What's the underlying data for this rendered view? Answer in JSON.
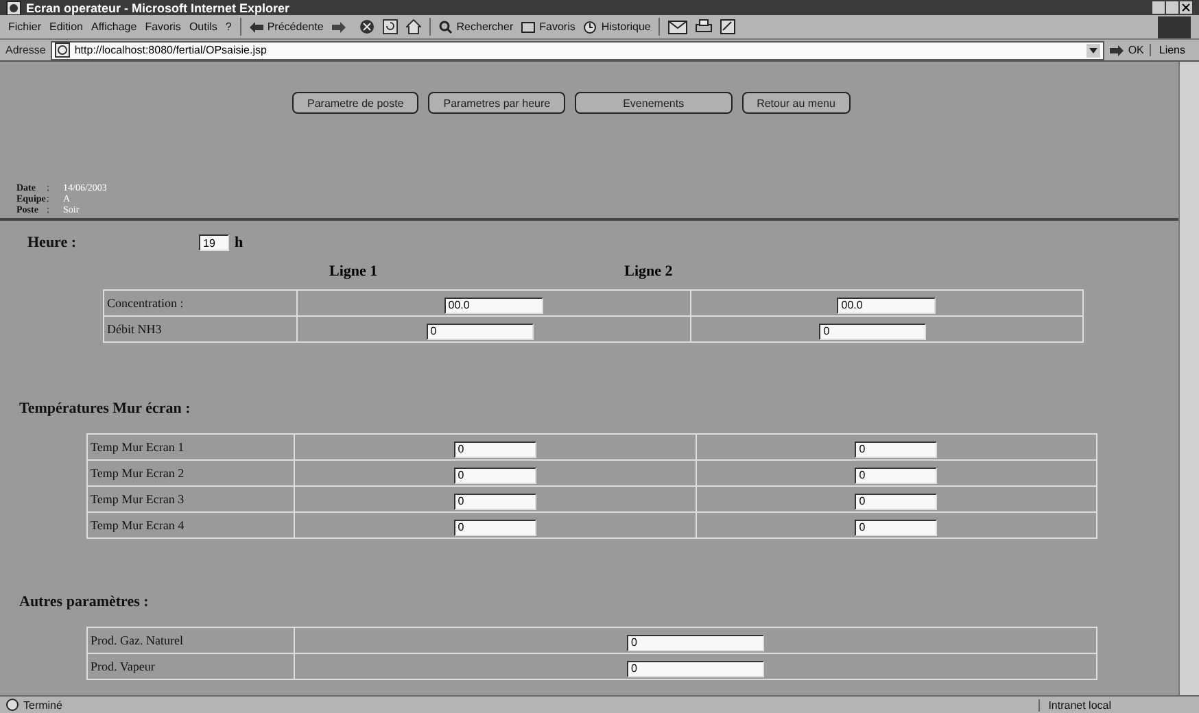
{
  "window": {
    "title": "Ecran operateur - Microsoft Internet Explorer"
  },
  "menu": [
    "Fichier",
    "Edition",
    "Affichage",
    "Favoris",
    "Outils",
    "?"
  ],
  "toolbar": {
    "back": "Précédente",
    "search": "Rechercher",
    "favorites": "Favoris",
    "history": "Historique"
  },
  "address": {
    "label": "Adresse",
    "url": "http://localhost:8080/fertial/OPsaisie.jsp",
    "go": "OK",
    "links": "Liens"
  },
  "nav_buttons": [
    "Parametre de poste",
    "Parametres par heure",
    "Evenements",
    "Retour au menu"
  ],
  "info": [
    {
      "label": "Date",
      "sep": ":",
      "value": "14/06/2003"
    },
    {
      "label": "Equipe",
      "sep": ":",
      "value": "A"
    },
    {
      "label": "Poste",
      "sep": ":",
      "value": "Soir"
    }
  ],
  "heure": {
    "label": "Heure :",
    "value": "19",
    "unit": "h"
  },
  "lines": [
    "Ligne 1",
    "Ligne 2"
  ],
  "production_table": [
    {
      "label": "Concentration :",
      "values": [
        "00.0",
        "00.0"
      ]
    },
    {
      "label": "Débit NH3",
      "values": [
        "0",
        "0"
      ]
    }
  ],
  "temperatures": {
    "title": "Températures Mur écran :",
    "rows": [
      {
        "label": "Temp Mur Ecran 1",
        "values": [
          "0",
          "0"
        ]
      },
      {
        "label": "Temp Mur Ecran 2",
        "values": [
          "0",
          "0"
        ]
      },
      {
        "label": "Temp Mur Ecran 3",
        "values": [
          "0",
          "0"
        ]
      },
      {
        "label": "Temp Mur Ecran 4",
        "values": [
          "0",
          "0"
        ]
      }
    ]
  },
  "autres": {
    "title": "Autres paramètres :",
    "rows": [
      {
        "label": "Prod. Gaz. Naturel",
        "value": "0"
      },
      {
        "label": "Prod. Vapeur",
        "value": "0"
      }
    ]
  },
  "status_bar": {
    "text": "Terminé",
    "zone": "Intranet local"
  }
}
